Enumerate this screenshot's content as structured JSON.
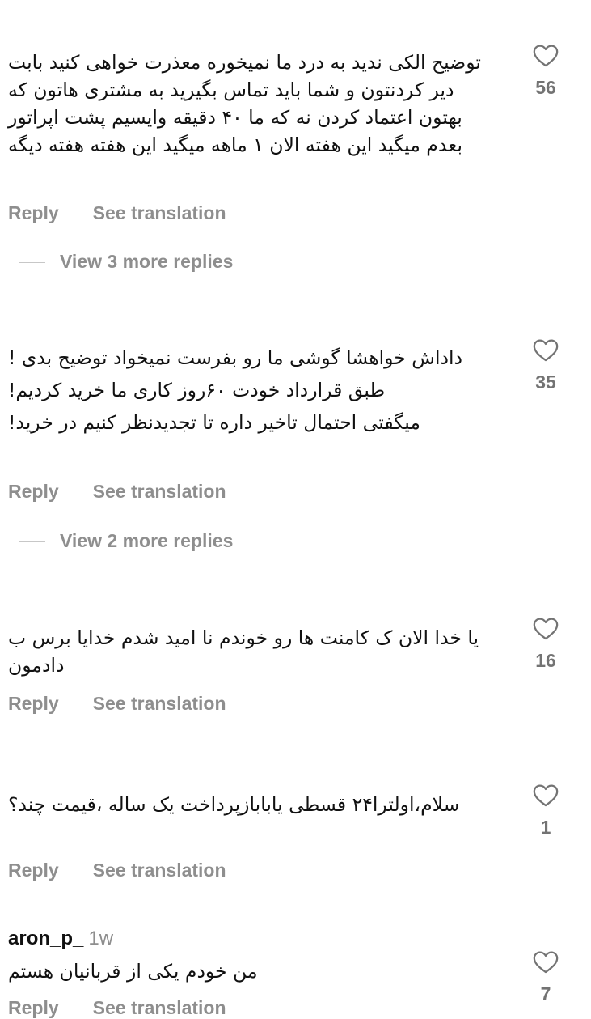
{
  "comments": [
    {
      "username": "",
      "lines": [
        "توضیح الکی ندید به درد ما نمیخوره معذرت خواهی کنید بابت دیر کردنتون و شما باید تماس بگیرید به مشتری هاتون که بهتون اعتماد کردن نه که ما ۴۰ دقیقه وایسیم پشت اپراتور بعدم میگید این هفته الان ۱ ماهه میگید این هفته هفته دیگه"
      ],
      "likes": "56",
      "reply": "Reply",
      "see_translation": "See translation",
      "more_replies": "View 3 more replies"
    },
    {
      "username": "",
      "lines": [
        "داداش خواهشا گوشی ما رو بفرست نمیخواد توضیح بدی !",
        "طبق قرارداد خودت ۶۰روز کاری ما خرید کردیم!",
        "میگفتی احتمال تاخیر داره تا تجدیدنظر کنیم در خرید!"
      ],
      "likes": "35",
      "reply": "Reply",
      "see_translation": "See translation",
      "more_replies": "View 2 more replies"
    },
    {
      "username": "",
      "lines": [
        "یا خدا الان ک کامنت ها رو خوندم نا امید شدم  خدایا برس  ب دادمون"
      ],
      "likes": "16",
      "reply": "Reply",
      "see_translation": "See translation"
    },
    {
      "username": "",
      "lines": [
        "سلام،اولترا۲۴ قسطی یابابازپرداخت یک ساله ،قیمت چند؟"
      ],
      "likes": "1",
      "reply": "Reply",
      "see_translation": "See translation"
    },
    {
      "username": "aron_p_",
      "time": "1w",
      "lines": [
        "من خودم یکی از قربانیان هستم"
      ],
      "likes": "7",
      "reply": "Reply",
      "see_translation": "See translation"
    }
  ]
}
